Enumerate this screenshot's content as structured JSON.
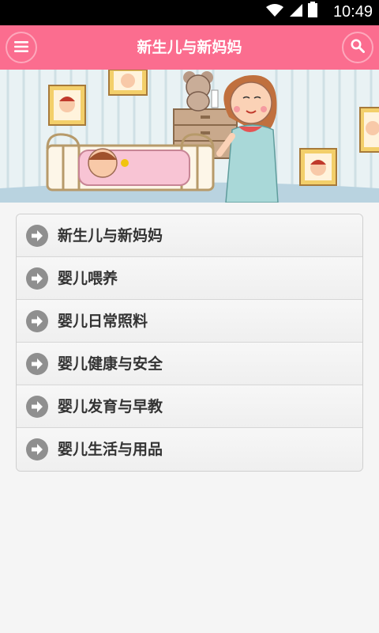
{
  "status_bar": {
    "time": "10:49"
  },
  "app_bar": {
    "title": "新生儿与新妈妈"
  },
  "menu": {
    "items": [
      {
        "label": "新生儿与新妈妈"
      },
      {
        "label": "婴儿喂养"
      },
      {
        "label": "婴儿日常照料"
      },
      {
        "label": "婴儿健康与安全"
      },
      {
        "label": "婴儿发育与早教"
      },
      {
        "label": "婴儿生活与用品"
      }
    ]
  },
  "colors": {
    "accent": "#fb6d8f",
    "arrow": "#8f8f8f"
  }
}
